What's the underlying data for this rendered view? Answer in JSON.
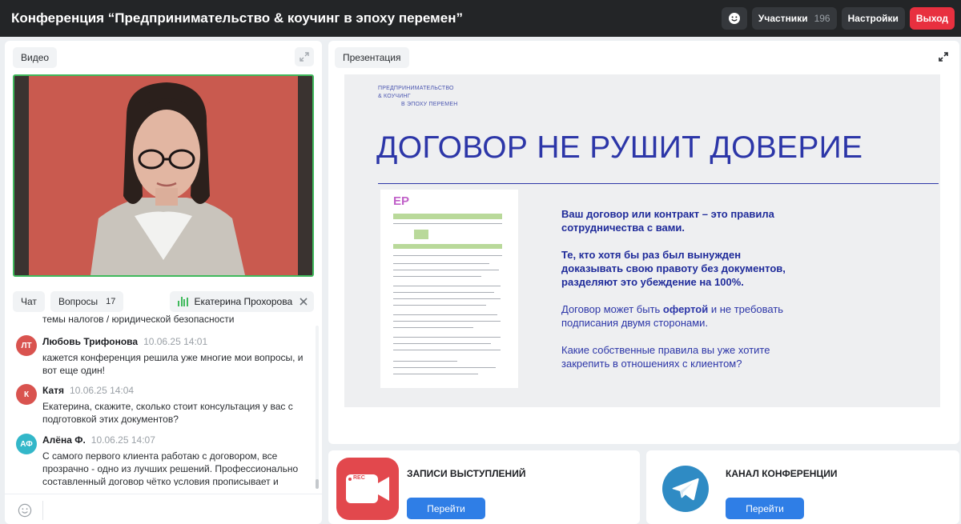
{
  "header": {
    "title": "Конференция “Предпринимательство & коучинг в эпоху перемен”",
    "participants_label": "Участники",
    "participants_count": "196",
    "settings_label": "Настройки",
    "exit_label": "Выход"
  },
  "video": {
    "label": "Видео"
  },
  "chat": {
    "tab_chat": "Чат",
    "tab_questions": "Вопросы",
    "questions_count": "17",
    "speaker_name": "Екатерина Прохорова",
    "previous_text": "темы налогов / юридической безопасности",
    "messages": [
      {
        "initials": "ЛТ",
        "avatar_color": "#d9534f",
        "name": "Любовь Трифонова",
        "time": "10.06.25 14:01",
        "text": "кажется конференция решила уже многие мои вопросы, и вот еще один!"
      },
      {
        "initials": "К",
        "avatar_color": "#d9534f",
        "name": "Катя",
        "time": "10.06.25 14:04",
        "text": "Екатерина, скажите, сколько стоит консультация у вас с подготовкой этих документов?"
      },
      {
        "initials": "АФ",
        "avatar_color": "#33b7c9",
        "name": "Алёна Ф.",
        "time": "10.06.25 14:07",
        "text": "С самого первого клиента работаю с договором, все прозрачно - одно из лучших решений. Профессионально составленный договор чётко условия прописывает и ответственность сторон"
      }
    ]
  },
  "presentation": {
    "label": "Презентация",
    "brand_line1": "ПРЕДПРИНИМАТЕЛЬСТВО",
    "brand_line2": "& КОУЧИНГ",
    "brand_line3": "В ЭПОХУ ПЕРЕМЕН",
    "headline": "ДОГОВОР НЕ РУШИТ ДОВЕРИЕ",
    "doc_logo": "EP",
    "para1": "Ваш договор или контракт – это правила сотрудничества с вами.",
    "para2": "Те, кто хотя бы раз был вынужден доказывать свою правоту без документов, разделяют это убеждение на 100%.",
    "para3_before": "Договор может быть ",
    "para3_strong": "офертой",
    "para3_after": " и не требовать подписания двумя сторонами.",
    "para4": "Какие собственные правила вы уже хотите закрепить в отношениях с клиентом?"
  },
  "cards": {
    "recordings_label": "ЗАПИСИ ВЫСТУПЛЕНИЙ",
    "recordings_button": "Перейти",
    "rec_badge": "REC",
    "channel_label": "КАНАЛ КОНФЕРЕНЦИИ",
    "channel_button": "Перейти"
  }
}
